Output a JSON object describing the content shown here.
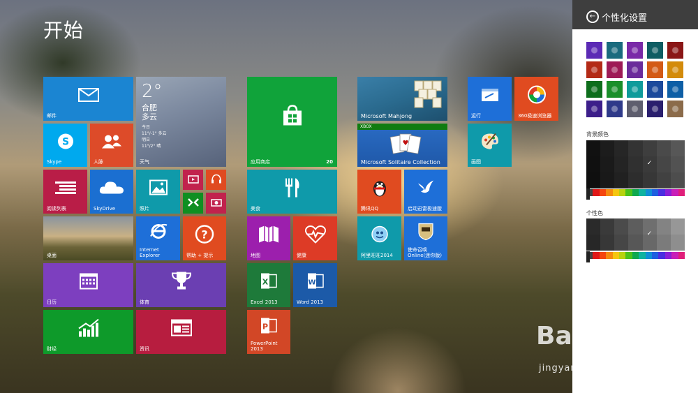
{
  "start": {
    "title": "开始"
  },
  "tiles": {
    "mail": {
      "label": "邮件",
      "color": "#1b85d2",
      "icon": "envelope-icon"
    },
    "weather": {
      "temp": "2°",
      "city": "合肥",
      "cond": "多云",
      "today": "今日",
      "today_fc": "11°/-1° 多云",
      "tomorrow": "明日",
      "tomorrow_fc": "11°/2° 晴",
      "label": "天气"
    },
    "skype": {
      "label": "Skype",
      "color": "#00a9ee"
    },
    "people": {
      "label": "人脉",
      "color": "#dd4b29"
    },
    "readinglist": {
      "label": "阅读列表",
      "color": "#b91d47"
    },
    "skydrive": {
      "label": "SkyDrive",
      "color": "#1b6fd1"
    },
    "photos": {
      "label": "照片",
      "color": "#0f9aaa"
    },
    "video": {
      "color": "#c1224d"
    },
    "music": {
      "color": "#e04b20"
    },
    "games": {
      "color": "#0f8f21"
    },
    "camera": {
      "color": "#c1224d"
    },
    "desktop": {
      "label": "桌面"
    },
    "ie": {
      "label": "Internet\nExplorer",
      "color": "#1e6fd8"
    },
    "help": {
      "label": "帮助 + 提示",
      "color": "#e04b20"
    },
    "calendar": {
      "label": "日历",
      "color": "#7d3fbf"
    },
    "sports": {
      "label": "体育",
      "color": "#6b3fb2"
    },
    "finance": {
      "label": "财经",
      "color": "#0e9a2a"
    },
    "news": {
      "label": "资讯",
      "color": "#b71d3f"
    },
    "store": {
      "label": "应用商店",
      "badge": "20",
      "color": "#10a33a"
    },
    "food": {
      "label": "美食",
      "color": "#0f9aaa"
    },
    "maps": {
      "label": "地图",
      "color": "#9c1fad"
    },
    "health": {
      "label": "健康",
      "color": "#dd3b26"
    },
    "excel": {
      "label": "Excel 2013",
      "color": "#1e7a3a"
    },
    "word": {
      "label": "Word 2013",
      "color": "#1c5aa8"
    },
    "powerpoint": {
      "label": "PowerPoint\n2013",
      "color": "#d24726"
    },
    "mahjong": {
      "label": "Microsoft Mahjong"
    },
    "solitaire": {
      "label": "Microsoft Solitaire Collection",
      "xbox": "XBOX"
    },
    "qq": {
      "label": "腾讯QQ",
      "color": "#e04b20"
    },
    "hibrowser": {
      "label": "启动迅雷极速版",
      "color": "#1e6fd8"
    },
    "alibaba": {
      "label": "阿里旺旺2014",
      "color": "#0f9aaa"
    },
    "mission": {
      "label": "使命召唤\nOnline(迷你版)",
      "color": "#1e6fd8"
    },
    "run": {
      "label": "运行",
      "color": "#1e6fd8"
    },
    "browser360": {
      "label": "360极速浏览器",
      "color": "#e04b20"
    },
    "paint": {
      "label": "画图",
      "color": "#0f9aaa"
    }
  },
  "panel": {
    "title": "个性化设置",
    "bg_color_label": "背景颜色",
    "accent_label": "个性色",
    "patterns": [
      "#5b2ab5",
      "#1a6b7e",
      "#7a2aa8",
      "#0f5d63",
      "#8a1616",
      "#b32a16",
      "#9e1a56",
      "#6b2c9b",
      "#d35b16",
      "#d38b0b",
      "#0e6e1c",
      "#1a8f2a",
      "#0f9b9b",
      "#1c4a9c",
      "#0e5fa6",
      "#3c1e8a",
      "#2f3a8a",
      "#5e5e6e",
      "#2a1f6e",
      "#8b6b4a"
    ],
    "bg_shades": [
      "#111111",
      "#1c1c1c",
      "#262626",
      "#333333",
      "#3e3e3e",
      "#4a4a4a",
      "#575757"
    ],
    "accent_shades": [
      "#2a2a2a",
      "#3a3a3a",
      "#4b4b4b",
      "#5d5d5d",
      "#6f6f6f",
      "#838383",
      "#979797"
    ],
    "rainbow": [
      "#444444",
      "#e01818",
      "#f5460f",
      "#f58a0f",
      "#f5c60f",
      "#b8d20f",
      "#4cc21a",
      "#0fa84e",
      "#0fb3a0",
      "#0f8fd6",
      "#1e5fe0",
      "#4a2ee0",
      "#8a1fd6",
      "#c81fb8",
      "#e01f7a"
    ]
  },
  "watermark": {
    "brand": "Bai 经验",
    "url": "jingyan.baidu.com"
  }
}
